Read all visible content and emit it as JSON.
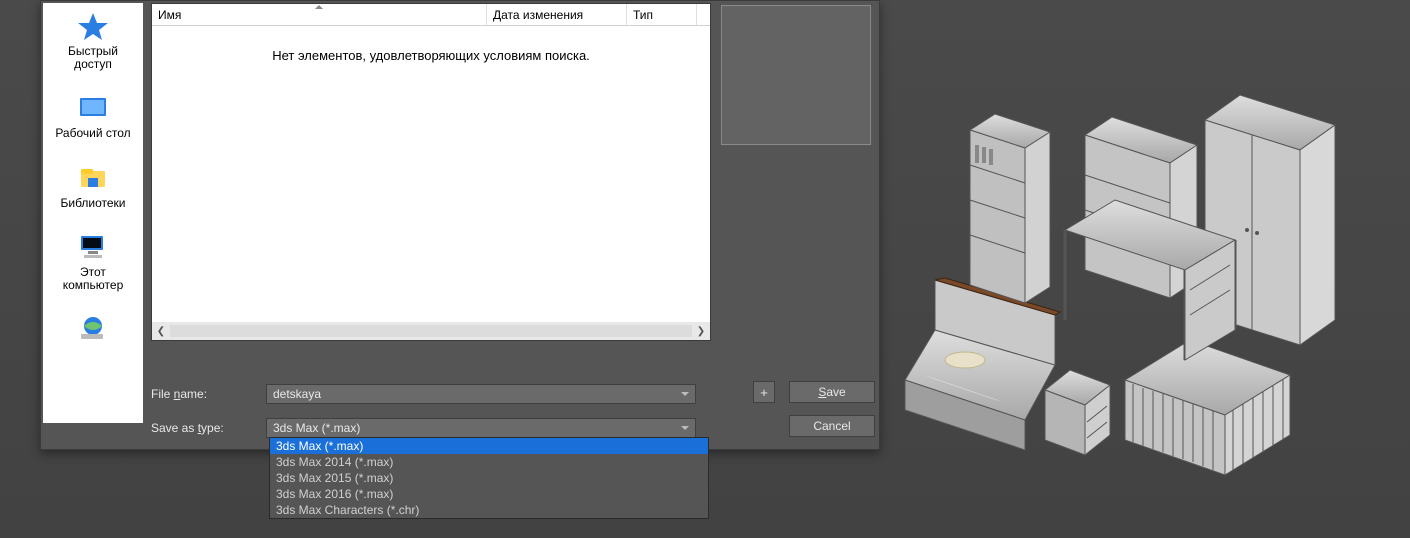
{
  "places": {
    "quick_access": "Быстрый\nдоступ",
    "desktop": "Рабочий стол",
    "libraries": "Библиотеки",
    "this_pc": "Этот\nкомпьютер"
  },
  "filelist": {
    "columns": {
      "name": "Имя",
      "date": "Дата изменения",
      "type": "Тип"
    },
    "empty_message": "Нет элементов, удовлетворяющих условиям поиска."
  },
  "form": {
    "filename_label_prefix": "File ",
    "filename_label_ul": "n",
    "filename_label_suffix": "ame:",
    "filename_value": "detskaya",
    "type_label_prefix": "Save as ",
    "type_label_ul": "t",
    "type_label_suffix": "ype:",
    "type_value": "3ds Max (*.max)"
  },
  "dropdown": {
    "options": [
      "3ds Max (*.max)",
      "3ds Max 2014 (*.max)",
      "3ds Max 2015 (*.max)",
      "3ds Max 2016 (*.max)",
      "3ds Max Characters (*.chr)"
    ]
  },
  "buttons": {
    "plus": "+",
    "save_ul": "S",
    "save_rest": "ave",
    "cancel": "Cancel"
  }
}
